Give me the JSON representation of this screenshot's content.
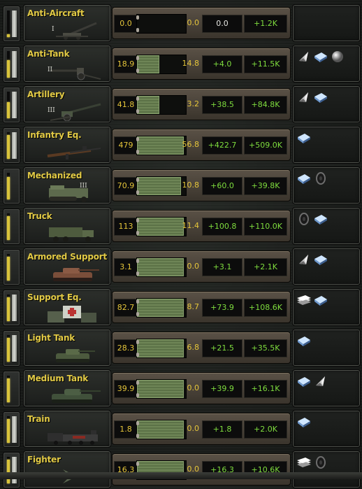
{
  "equipment": [
    {
      "name": "Anti-Aircraft",
      "tier": "I",
      "pic": "anti-aircraft-gun",
      "stock_fraction": 0.1,
      "bright": true,
      "progress": 0.0,
      "value1": "0.0",
      "value2": "0.0",
      "value3": "0.0",
      "value3_color": "gray",
      "value4": "+1.2K",
      "resources": []
    },
    {
      "name": "Anti-Tank",
      "tier": "II",
      "pic": "anti-tank-gun",
      "stock_fraction": 0.65,
      "bright": true,
      "progress": 0.45,
      "value1": "18.9",
      "value2": "14.8",
      "value3": "+4.0",
      "value3_color": "green",
      "value4": "+11.5K",
      "resources": [
        "cone-icon",
        "steel-icon",
        "ball-icon"
      ]
    },
    {
      "name": "Artillery",
      "tier": "III",
      "pic": "artillery-gun",
      "stock_fraction": 0.6,
      "bright": true,
      "progress": 0.45,
      "value1": "41.8",
      "value2": "3.2",
      "value3": "+38.5",
      "value3_color": "green",
      "value4": "+84.8K",
      "resources": [
        "cone-icon",
        "steel-icon"
      ]
    },
    {
      "name": "Infantry Eq.",
      "tier": "",
      "pic": "rifle",
      "stock_fraction": 0.9,
      "bright": true,
      "progress": 0.95,
      "value1": "479",
      "value2": "56.8",
      "value3": "+422.7",
      "value3_color": "green",
      "value4": "+509.0K",
      "resources": [
        "steel-icon"
      ]
    },
    {
      "name": "Mechanized",
      "tier": "III",
      "pic": "halftrack",
      "stock_fraction": 0.85,
      "bright": false,
      "progress": 0.9,
      "value1": "70.9",
      "value2": "10.8",
      "value3": "+60.0",
      "value3_color": "green",
      "value4": "+39.8K",
      "resources": [
        "steel-icon",
        "tire-icon"
      ]
    },
    {
      "name": "Truck",
      "tier": "",
      "pic": "truck",
      "stock_fraction": 0.9,
      "bright": false,
      "progress": 0.95,
      "value1": "113",
      "value2": "11.4",
      "value3": "+100.8",
      "value3_color": "green",
      "value4": "+110.0K",
      "resources": [
        "tire-icon",
        "steel-icon"
      ]
    },
    {
      "name": "Armored Support ...",
      "tier": "",
      "pic": "armored-support-tank",
      "stock_fraction": 0.9,
      "bright": false,
      "progress": 0.95,
      "value1": "3.1",
      "value2": "0.0",
      "value3": "+3.1",
      "value3_color": "green",
      "value4": "+2.1K",
      "resources": [
        "cone-icon",
        "steel-icon"
      ]
    },
    {
      "name": "Support Eq.",
      "tier": "",
      "pic": "support-crates",
      "stock_fraction": 0.9,
      "bright": true,
      "progress": 0.95,
      "value1": "82.7",
      "value2": "8.7",
      "value3": "+73.9",
      "value3_color": "green",
      "value4": "+108.6K",
      "resources": [
        "plates-icon",
        "steel-icon"
      ]
    },
    {
      "name": "Light Tank",
      "tier": "",
      "pic": "light-tank",
      "stock_fraction": 0.9,
      "bright": true,
      "progress": 0.95,
      "value1": "28.3",
      "value2": "6.8",
      "value3": "+21.5",
      "value3_color": "green",
      "value4": "+35.5K",
      "resources": [
        "steel-icon"
      ]
    },
    {
      "name": "Medium Tank",
      "tier": "",
      "pic": "medium-tank",
      "stock_fraction": 0.9,
      "bright": false,
      "progress": 0.95,
      "value1": "39.9",
      "value2": "0.0",
      "value3": "+39.9",
      "value3_color": "green",
      "value4": "+16.1K",
      "resources": [
        "steel-icon",
        "cone-icon"
      ]
    },
    {
      "name": "Train",
      "tier": "",
      "pic": "train",
      "stock_fraction": 0.9,
      "bright": true,
      "progress": 0.95,
      "value1": "1.8",
      "value2": "0.0",
      "value3": "+1.8",
      "value3_color": "green",
      "value4": "+2.0K",
      "resources": [
        "steel-icon"
      ]
    },
    {
      "name": "Fighter",
      "tier": "",
      "pic": "fighter-plane",
      "stock_fraction": 0.9,
      "bright": true,
      "progress": 0.95,
      "value1": "16.3",
      "value2": "0.0",
      "value3": "+16.3",
      "value3_color": "green",
      "value4": "+10.6K",
      "resources": [
        "plates-icon",
        "tire-icon"
      ]
    }
  ],
  "colors": {
    "yellow": "#e6c63a",
    "green": "#7fdd3e",
    "gray": "#e7e7e3",
    "name": "#e2ca45"
  }
}
